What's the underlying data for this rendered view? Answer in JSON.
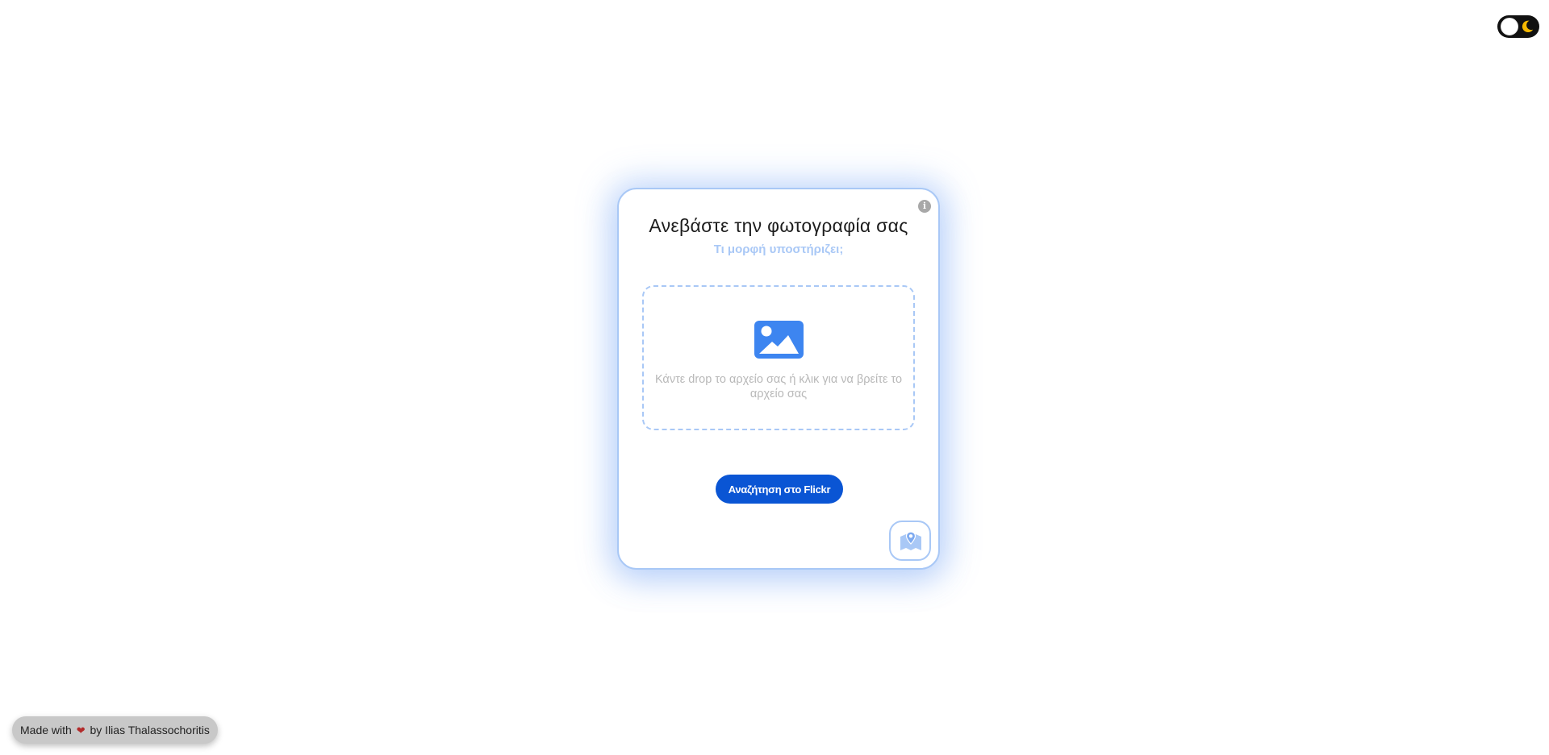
{
  "theme_toggle": {
    "icon": "moon-icon",
    "moon_color": "#f5b800"
  },
  "card": {
    "info_icon": "i",
    "title": "Ανεβάστε την φωτογραφία σας",
    "formats_link": "Τι μορφή υποστήριζει;",
    "dropzone": {
      "icon": "image-icon",
      "text": "Κάντε drop το αρχείο σας ή κλικ για να βρείτε το αρχείο σας"
    },
    "flickr_button": "Αναζήτηση στο Flickr",
    "map_button_icon": "map-pin-icon"
  },
  "footer": {
    "made_with": "Made with",
    "by": "by Ilias Thalassochoritis"
  },
  "colors": {
    "accent": "#0a55d4",
    "card_border": "#a9c8f6",
    "image_icon": "#3d85f0"
  }
}
